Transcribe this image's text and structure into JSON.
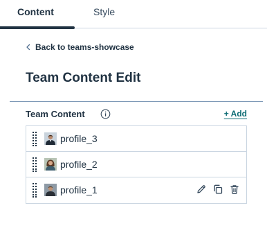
{
  "tabs": [
    {
      "label": "Content",
      "active": true
    },
    {
      "label": "Style",
      "active": false
    }
  ],
  "back_link": {
    "label": "Back to teams-showcase",
    "icon": "chevron-left-icon"
  },
  "page_title": "Team Content Edit",
  "team_content": {
    "label": "Team Content",
    "info_icon": "info-icon",
    "add_label": "+ Add",
    "items": [
      {
        "label": "profile_3",
        "avatar": "avatar-man-dark-jacket"
      },
      {
        "label": "profile_2",
        "avatar": "avatar-woman"
      },
      {
        "label": "profile_1",
        "avatar": "avatar-man",
        "actions": [
          "pencil-icon",
          "copy-icon",
          "trash-icon"
        ]
      }
    ]
  },
  "colors": {
    "text": "#213343",
    "link": "#0b6b73",
    "border": "#cbd6e2"
  }
}
